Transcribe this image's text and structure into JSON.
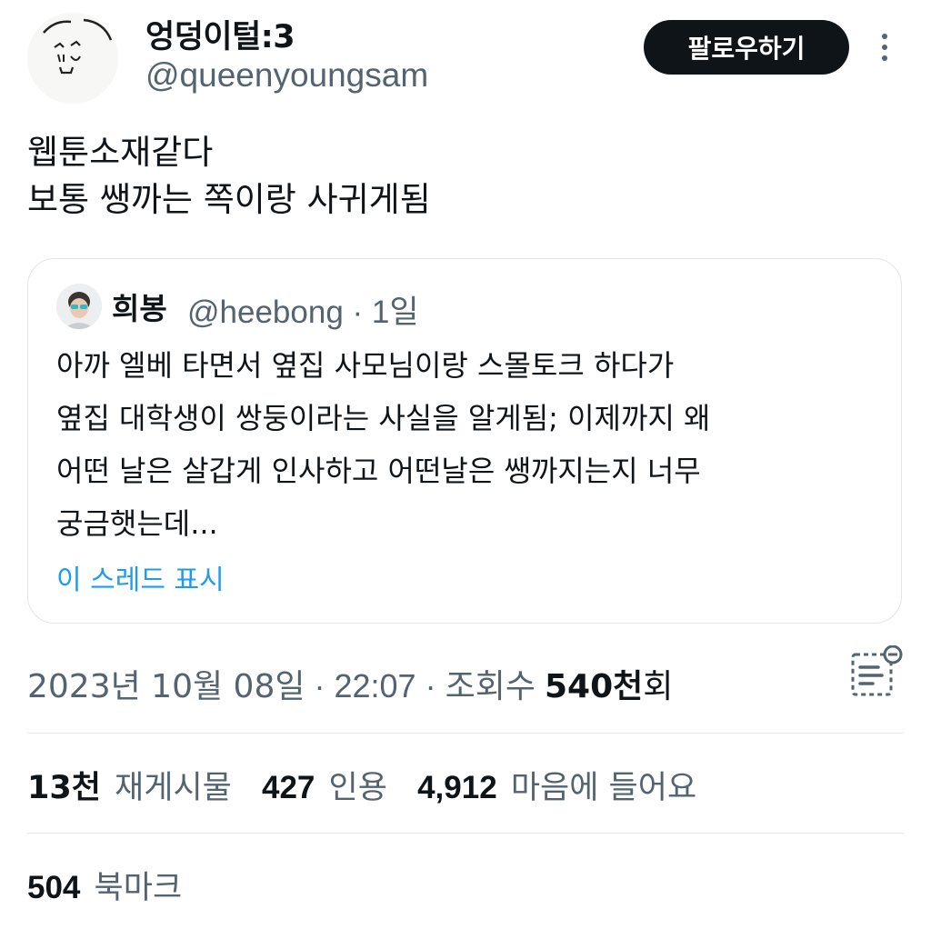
{
  "author": {
    "display_name": "엉덩이털:3",
    "handle": "@queenyoungsam",
    "avatar_icon": "doodle-face-avatar"
  },
  "header": {
    "follow_label": "팔로우하기",
    "more_icon": "more-vertical-icon"
  },
  "tweet": {
    "lines": [
      "웹툰소재같다",
      "보통 쌩까는 쪽이랑 사귀게됨"
    ]
  },
  "quote": {
    "display_name": "희봉",
    "meta": "@heebong · 1일",
    "lines": [
      "아까 엘베 타면서 옆집 사모님이랑 스몰토크 하다가",
      "옆집 대학생이 쌍둥이라는 사실을 알게됨; 이제까지 왜",
      "어떤 날은 살갑게 인사하고 어떤날은 쌩까지는지 너무",
      "궁금햇는데..."
    ],
    "show_thread_label": "이 스레드 표시"
  },
  "timestamp": {
    "date": "2023년 10월 08일",
    "time": "· 22:07 ·",
    "views_label": "조회수",
    "views_count": "540천",
    "views_unit": "회"
  },
  "stats": {
    "reposts_count": "13천",
    "reposts_label": "재게시물",
    "quotes_count": "427",
    "quotes_label": "인용",
    "likes_count": "4,912",
    "likes_label": "마음에 들어요",
    "bookmarks_count": "504",
    "bookmarks_label": "북마크"
  },
  "colors": {
    "text_primary": "#0f1419",
    "text_secondary": "#536471",
    "link": "#1d9bf0",
    "border": "#e1e6ea"
  }
}
